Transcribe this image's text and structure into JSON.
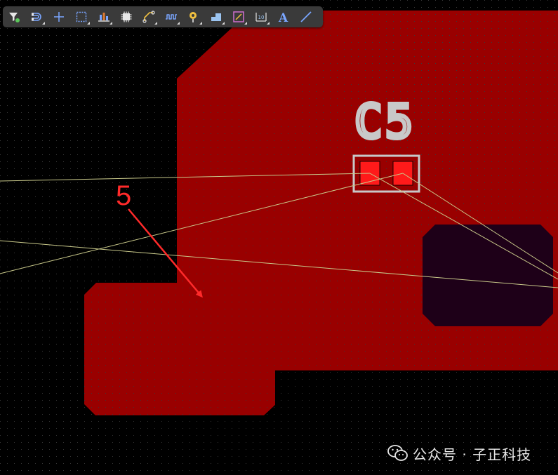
{
  "toolbar": {
    "items": [
      {
        "name": "filter-icon"
      },
      {
        "name": "snap-magnet-icon"
      },
      {
        "name": "crosshair-icon"
      },
      {
        "name": "select-area-icon"
      },
      {
        "name": "align-icon"
      },
      {
        "name": "component-icon"
      },
      {
        "name": "route-track-icon"
      },
      {
        "name": "tune-length-icon"
      },
      {
        "name": "via-icon"
      },
      {
        "name": "polygon-pour-icon"
      },
      {
        "name": "keepout-icon"
      },
      {
        "name": "dimension-icon"
      },
      {
        "name": "text-icon"
      },
      {
        "name": "line-icon"
      }
    ]
  },
  "pcb": {
    "component_designator": "C5",
    "annotation_number": "5",
    "colors": {
      "copper_pour": "#990000",
      "pad": "#ff1a1a",
      "silkscreen": "#c8c8c8",
      "ratsnest": "#c9c98a",
      "cutout": "#1e0018",
      "annotation": "#ff2a2a",
      "background": "#000000"
    }
  },
  "watermark": {
    "text": "公众号 · 子正科技"
  }
}
